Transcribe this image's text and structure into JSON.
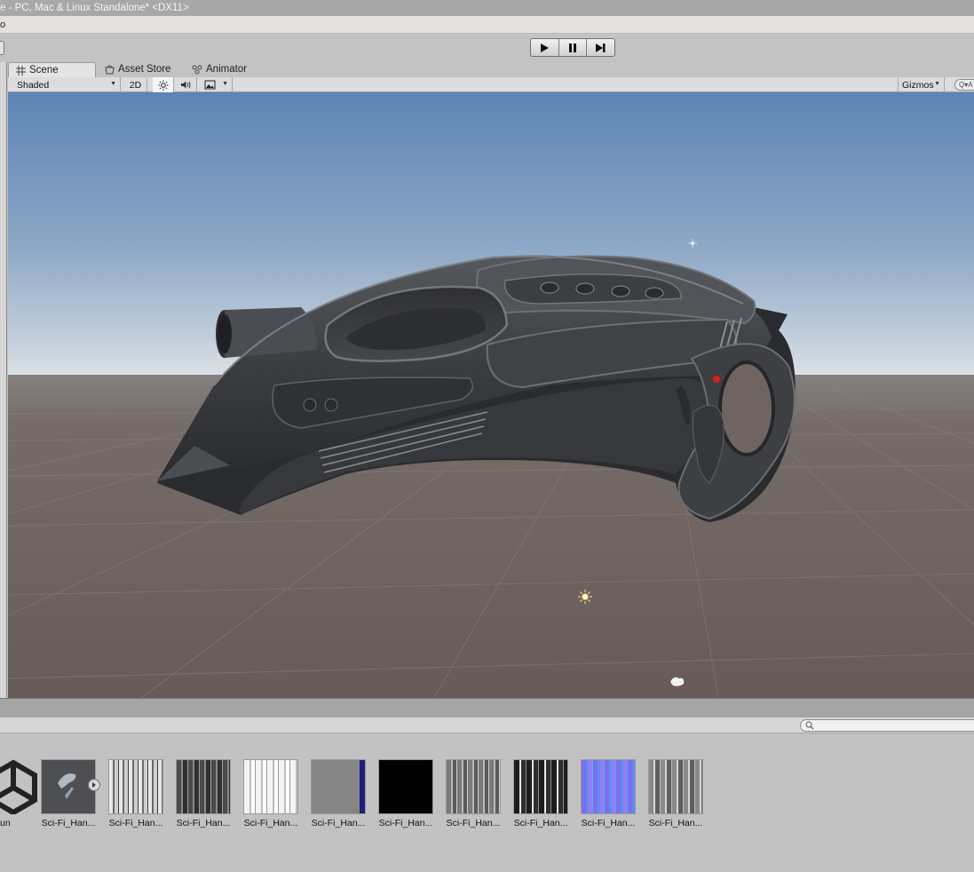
{
  "window": {
    "title": "e - PC, Mac & Linux Standalone* <DX11>",
    "menu_fragment": "o"
  },
  "toolbar": {
    "play_icon": "play-icon",
    "pause_icon": "pause-icon",
    "step_icon": "step-icon"
  },
  "tabs": [
    {
      "label": "Scene",
      "icon": "scene-grid-icon",
      "active": true
    },
    {
      "label": "Asset Store",
      "icon": "asset-store-icon",
      "active": false
    },
    {
      "label": "Animator",
      "icon": "animator-icon",
      "active": false
    }
  ],
  "scene_toolbar": {
    "shading_mode": "Shaded",
    "mode_2d": "2D",
    "gizmos_label": "Gizmos",
    "search_placeholder": "Q▾A"
  },
  "scene": {
    "sky_top": "#5f86b8",
    "horizon": "#d5dde2",
    "ground": "#6e635e"
  },
  "assets": [
    {
      "label": "un",
      "kind": "unity-logo"
    },
    {
      "label": "Sci-Fi_Han...",
      "kind": "model-prefab"
    },
    {
      "label": "Sci-Fi_Han...",
      "kind": "texture-light"
    },
    {
      "label": "Sci-Fi_Han...",
      "kind": "texture-dark"
    },
    {
      "label": "Sci-Fi_Han...",
      "kind": "texture-white"
    },
    {
      "label": "Sci-Fi_Han...",
      "kind": "texture-gray-blue"
    },
    {
      "label": "Sci-Fi_Han...",
      "kind": "texture-black"
    },
    {
      "label": "Sci-Fi_Han...",
      "kind": "texture-gray"
    },
    {
      "label": "Sci-Fi_Han...",
      "kind": "texture-dark-white"
    },
    {
      "label": "Sci-Fi_Han...",
      "kind": "texture-normal"
    },
    {
      "label": "Sci-Fi_Han...",
      "kind": "texture-gray-2"
    }
  ]
}
